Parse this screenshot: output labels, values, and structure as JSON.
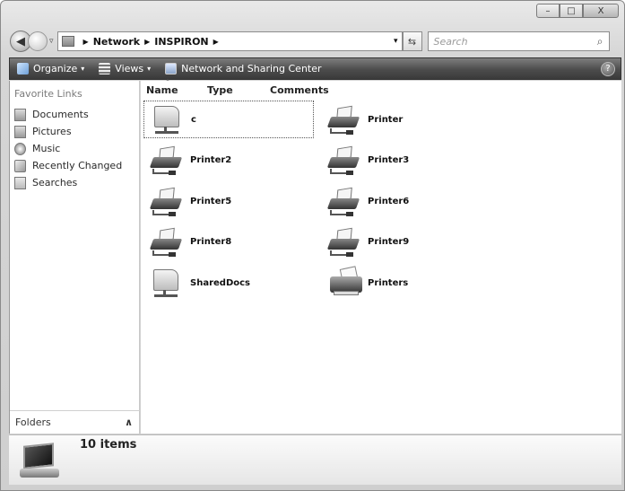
{
  "window": {
    "caption": {
      "minimize": "–",
      "maximize": "□",
      "close": "X"
    }
  },
  "address": {
    "back_icon": "◀",
    "history_caret": "▿",
    "crumbs": [
      "Network",
      "INSPIRON"
    ],
    "crumb_sep": "▶",
    "dropdown": "▾",
    "refresh_icon": "⇆",
    "search_placeholder": "Search",
    "search_icon": "⌕"
  },
  "toolbar": {
    "organize": "Organize",
    "views": "Views",
    "network_center": "Network and Sharing Center",
    "caret": "▾",
    "help": "?"
  },
  "sidebar": {
    "title": "Favorite Links",
    "items": [
      {
        "label": "Documents",
        "icon": "documents-icon"
      },
      {
        "label": "Pictures",
        "icon": "pictures-icon"
      },
      {
        "label": "Music",
        "icon": "music-icon"
      },
      {
        "label": "Recently Changed",
        "icon": "recently-changed-icon"
      },
      {
        "label": "Searches",
        "icon": "searches-icon"
      }
    ],
    "folders_label": "Folders",
    "folders_chevron": "∧"
  },
  "columns": {
    "name": "Name",
    "type": "Type",
    "comments": "Comments",
    "sort_indicator": "ˆ"
  },
  "items": [
    {
      "label": "c",
      "kind": "share",
      "selected": true
    },
    {
      "label": "Printer",
      "kind": "printer"
    },
    {
      "label": "Printer2",
      "kind": "printer"
    },
    {
      "label": "Printer3",
      "kind": "printer"
    },
    {
      "label": "Printer5",
      "kind": "printer"
    },
    {
      "label": "Printer6",
      "kind": "printer"
    },
    {
      "label": "Printer8",
      "kind": "printer"
    },
    {
      "label": "Printer9",
      "kind": "printer"
    },
    {
      "label": "SharedDocs",
      "kind": "share"
    },
    {
      "label": "Printers",
      "kind": "printers-folder"
    }
  ],
  "details": {
    "count": "10 items"
  }
}
